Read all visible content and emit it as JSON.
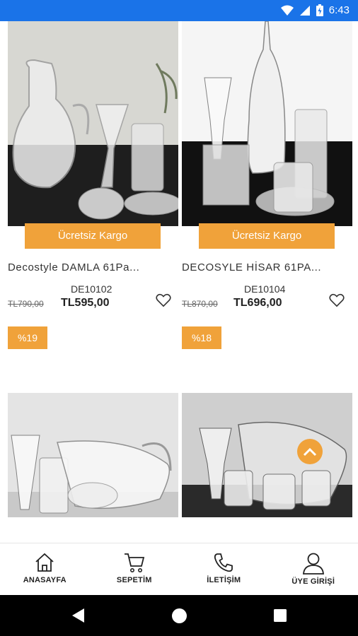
{
  "status_bar": {
    "time": "6:43",
    "bg_color": "#1a73e8"
  },
  "colors": {
    "accent": "#f0a23a"
  },
  "products": [
    {
      "shipping_badge": "Ücretsiz Kargo",
      "title": "Decostyle DAMLA 61Pa...",
      "code": "DE10102",
      "old_price": "TL790,00",
      "price": "TL595,00",
      "discount": "%19"
    },
    {
      "shipping_badge": "Ücretsiz Kargo",
      "title": "DECOSYLE HİSAR 61PA...",
      "code": "DE10104",
      "old_price": "TL870,00",
      "price": "TL696,00",
      "discount": "%18"
    },
    {
      "image": "glass-set-photo"
    },
    {
      "image": "glass-set-photo"
    }
  ],
  "bottom_nav": {
    "items": [
      {
        "label": "ANASAYFA",
        "icon": "home-icon"
      },
      {
        "label": "SEPETİM",
        "icon": "cart-icon"
      },
      {
        "label": "İLETİŞİM",
        "icon": "phone-icon"
      },
      {
        "label": "ÜYE GİRİŞİ",
        "icon": "user-icon"
      }
    ]
  }
}
